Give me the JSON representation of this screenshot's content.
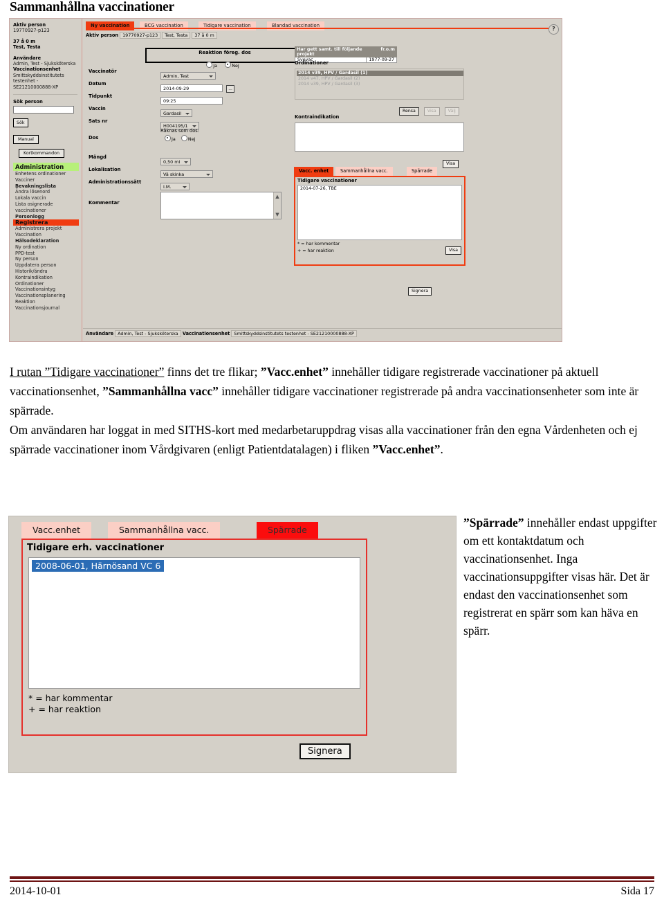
{
  "document": {
    "title": "Sammanhållna vaccinationer",
    "footer": {
      "date": "2014-10-01",
      "page": "Sida 17"
    }
  },
  "screenshot_top": {
    "tabs": [
      {
        "label": "Ny vaccination",
        "active": true
      },
      {
        "label": "BCG vaccination",
        "active": false
      },
      {
        "label": "Tidigare vaccination",
        "active": false
      },
      {
        "label": "Blandad vaccination",
        "active": false
      }
    ],
    "help_icon": "?",
    "person_bar": {
      "label": "Aktiv person",
      "id": "19770927-p123",
      "name": "Test, Testa",
      "age": "37 å 0 m"
    },
    "sidebar": {
      "active_person_label": "Aktiv person",
      "active_person_id": "19770927-p123",
      "age": "37 å 0 m",
      "name": "Test, Testa",
      "user_label": "Användare",
      "user_value": "Admin, Test - Sjuksköterska",
      "unit_label": "Vaccinationsenhet",
      "unit_value": "Smittskyddsinstitutets testenhet - SE21210000888-XP",
      "search_label": "Sök person",
      "search_value": "",
      "search_button": "Sök",
      "manual_button": "Manual",
      "shortcuts_button": "Kortkommandon",
      "menu_admin_header": "Administration",
      "menu_admin_items": [
        "Enhetens ordinationer",
        "Vacciner",
        "Bevakningslista",
        "Ändra lösenord",
        "Lokala vaccin",
        "Lista osignerade vaccinationer",
        "Personlogg"
      ],
      "menu_register_header": "Registrera",
      "menu_register_items": [
        "Administrera projekt",
        "Vaccination",
        "Hälsodeklaration",
        "Ny ordination",
        "PPD-test",
        "Ny person",
        "Uppdatera person",
        "Historik/ändra",
        "Kontraindikation",
        "Ordinationer",
        "Vaccinationsintyg",
        "Vaccinationsplanering",
        "Reaktion",
        "Vaccinationsjournal"
      ]
    },
    "form": {
      "reaction_box_title": "Reaktion föreg. dos",
      "reaction_yes": "Ja",
      "reaction_no": "Nej",
      "reaction_selected": "Nej",
      "vaccinator_label": "Vaccinatör",
      "vaccinator_value": "Admin, Test",
      "date_label": "Datum",
      "date_value": "2014-09-29",
      "date_picker_button": "...",
      "time_label": "Tidpunkt",
      "time_value": "09:25",
      "vaccine_label": "Vaccin",
      "vaccine_value": "Gardasil",
      "batch_label": "Sats nr",
      "batch_value": "H004195/1",
      "dose_label": "Dos",
      "dose_counts_label": "Räknas som dos:",
      "dose_yes": "Ja",
      "dose_no": "Nej",
      "dose_selected": "Ja",
      "amount_label": "Mängd",
      "amount_value": "0,50 ml",
      "location_label": "Lokalisation",
      "location_value": "Vä skinka",
      "admin_route_label": "Administrationssätt",
      "admin_route_value": "I.M.",
      "comment_label": "Kommentar",
      "comment_value": ""
    },
    "consent": {
      "header_project": "Har gett samt. till följande projekt",
      "header_from": "fr.o.m",
      "row_project": "Svevac",
      "row_from": "1977-09-27"
    },
    "ordinationer": {
      "label": "Ordinationer",
      "items": [
        {
          "text": "2014 v39, HPV / Gardasil (1)",
          "selected": true
        },
        {
          "text": "2014 v47, HPV / Gardasil (2)",
          "selected": false
        },
        {
          "text": "2014 v39, HPV / Gardasil (3)",
          "selected": false
        }
      ],
      "buttons": [
        {
          "label": "Rensa",
          "disabled": false
        },
        {
          "label": "Visa",
          "disabled": true
        },
        {
          "label": "Välj",
          "disabled": true
        }
      ]
    },
    "contraindication": {
      "label": "Kontraindikation",
      "value": ""
    },
    "visa_button_1": "Visa",
    "previous": {
      "tabs": [
        {
          "label": "Vacc. enhet",
          "active": true
        },
        {
          "label": "Sammanhållna vacc.",
          "active": false
        },
        {
          "label": "Spärrade",
          "active": false
        }
      ],
      "title": "Tidigare vaccinationer",
      "items": [
        "2014-07-26, TBE"
      ],
      "legend_comment": "* = har kommentar",
      "legend_reaction": "+ = har reaktion",
      "visa_button": "Visa",
      "sign_button": "Signera"
    },
    "status_bar": {
      "user_label": "Användare",
      "user_value": "Admin, Test - Sjuksköterska",
      "unit_label": "Vaccinationsenhet",
      "unit_value": "Smittskyddsinstitutets testenhet - SE21210000888-XP"
    }
  },
  "paragraph_1": {
    "part1": "I rutan ”Tidigare vaccinationer”",
    "part2": " finns det tre flikar; ",
    "part3": "”Vacc.enhet”",
    "part4": " innehåller tidigare registrerade vaccinationer på aktuell vaccinationsenhet, ",
    "part5": "”Sammanhållna vacc”",
    "part6": " innehåller tidigare vaccinationer registrerade på andra vaccinationsenheter som inte är spärrade."
  },
  "paragraph_2": {
    "part1": "Om användaren har loggat in med SITHS-kort med medarbetaruppdrag visas alla vaccinationer från den egna Vårdenheten och ej spärrade vaccinationer inom Vårdgivaren (enligt Patientdatalagen) i fliken ",
    "part2": "”Vacc.enhet”",
    "part3": "."
  },
  "screenshot_bottom": {
    "tabs": [
      {
        "label": "Vacc.enhet",
        "active": false
      },
      {
        "label": "Sammanhållna vacc.",
        "active": false
      },
      {
        "label": "Spärrade",
        "active": true
      }
    ],
    "title": "Tidigare erh. vaccinationer",
    "items": [
      "2008-06-01, Härnösand VC 6"
    ],
    "legend_comment": "* = har kommentar",
    "legend_reaction": "+ = har reaktion",
    "sign_button": "Signera"
  },
  "paragraph_3": {
    "part1": "”Spärrade”",
    "part2": " innehåller endast uppgifter om ett kontaktdatum och vaccinationsenhet. Inga vaccinationsuppgifter visas här. Det är endast den vaccinationsenhet som registrerat en spärr som kan häva en spärr."
  },
  "colors": {
    "tab_active": "#f03c11",
    "tab_inactive": "#fbcfc5",
    "menu_header_green": "#b7f07a",
    "selection_blue": "#2b6cb5",
    "footer_rule": "#6e1414",
    "panel_bg": "#d4d0c8"
  }
}
